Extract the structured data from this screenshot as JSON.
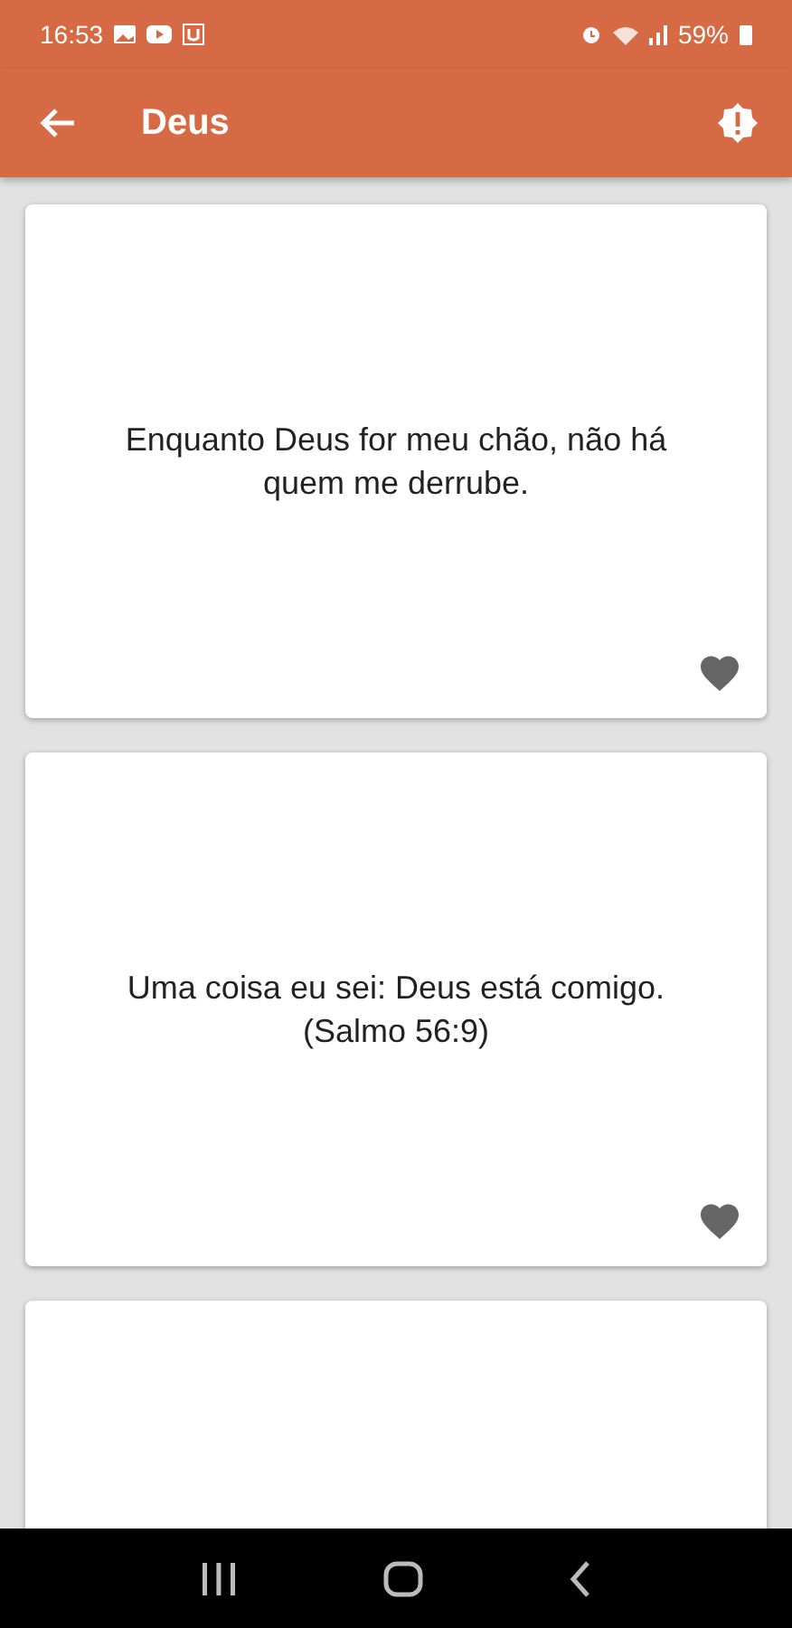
{
  "status_bar": {
    "time": "16:53",
    "battery": "59%"
  },
  "app_bar": {
    "title": "Deus"
  },
  "quotes": [
    {
      "text": "Enquanto Deus for meu chão, não há quem me derrube.",
      "favorite": false
    },
    {
      "text": "Uma coisa eu sei: Deus está comigo. (Salmo 56:9)",
      "favorite": false
    }
  ]
}
